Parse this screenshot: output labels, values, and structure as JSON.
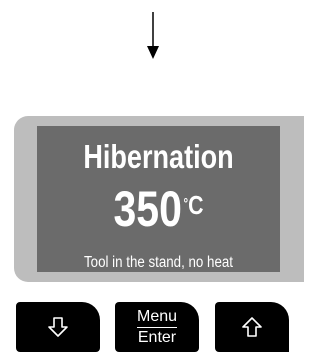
{
  "screen": {
    "title": "Hibernation",
    "temperature": "350",
    "unit": "C",
    "degree_symbol": "°",
    "message": "Tool in the stand, no heat"
  },
  "buttons": {
    "menu_top": "Menu",
    "menu_bottom": "Enter",
    "down_icon": "down-arrow-icon",
    "up_icon": "up-arrow-icon"
  },
  "colors": {
    "screen_bg": "#6b6b6b",
    "device_bezel": "#bdbdbd",
    "button_bg": "#000000",
    "text": "#ffffff"
  }
}
